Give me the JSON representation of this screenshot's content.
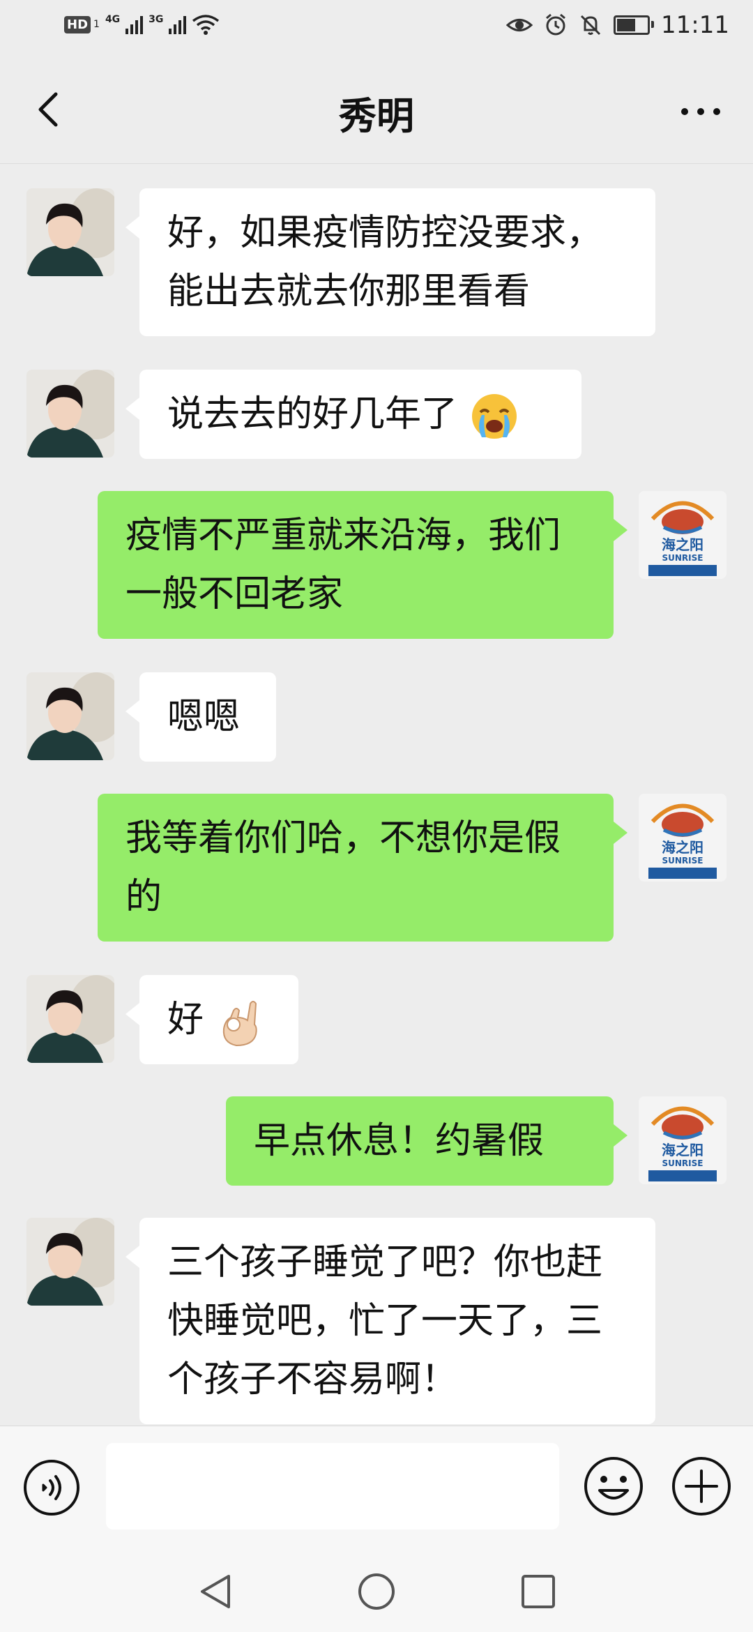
{
  "status_bar": {
    "hd_label": "HD",
    "sim1_sub": "1",
    "net1": "4G",
    "net2": "3G",
    "time": "11:11",
    "battery_level": 0.6,
    "icons": [
      "eye-icon",
      "alarm-icon",
      "mute-icon",
      "battery-icon",
      "wifi-icon",
      "signal-icon"
    ]
  },
  "header": {
    "title": "秀明",
    "back_icon": "chevron-left-icon",
    "more_icon": "more-icon"
  },
  "messages": [
    {
      "side": "in",
      "text": "好，如果疫情防控没要求，能出去就去你那里看看"
    },
    {
      "side": "in",
      "text": "说去去的好几年了",
      "emoji": "loudly-crying-face-icon"
    },
    {
      "side": "out",
      "text": "疫情不严重就来沿海，我们一般不回老家"
    },
    {
      "side": "in",
      "text": "嗯嗯"
    },
    {
      "side": "out",
      "text": "我等着你们哈，不想你是假的"
    },
    {
      "side": "in",
      "text": "好",
      "emoji": "ok-hand-icon"
    },
    {
      "side": "out",
      "text": "早点休息！约暑假"
    },
    {
      "side": "in",
      "text": "三个孩子睡觉了吧？你也赶快睡觉吧，忙了一天了，三个孩子不容易啊！"
    }
  ],
  "avatar_logo": {
    "brand_cn": "海之阳",
    "brand_en": "SUNRISE"
  },
  "input_bar": {
    "voice_icon": "voice-icon",
    "emoji_icon": "smile-icon",
    "plus_icon": "plus-icon",
    "value": ""
  },
  "nav_bar": {
    "icons": [
      "nav-back-icon",
      "nav-home-icon",
      "nav-recent-icon"
    ]
  },
  "colors": {
    "background": "#ededed",
    "incoming_bubble": "#ffffff",
    "outgoing_bubble": "#95ec69"
  }
}
